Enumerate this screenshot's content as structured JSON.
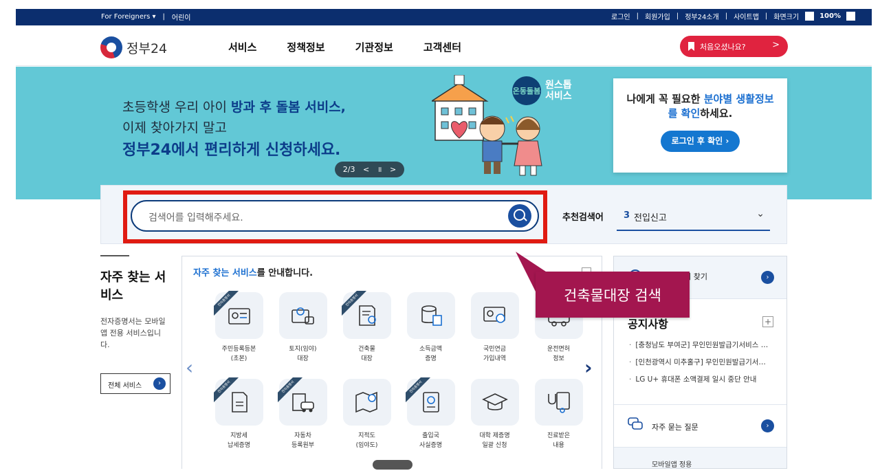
{
  "topbar": {
    "foreigners": "For Foreigners ▾",
    "kids": "어린이",
    "login": "로그인",
    "signup": "회원가입",
    "intro": "정부24소개",
    "sitemap": "사이트맵",
    "zoom_label": "화면크기",
    "zoom_minus": "-",
    "zoom_value": "100%",
    "zoom_plus": "+"
  },
  "header": {
    "logo_text": "정부24",
    "nav": [
      "서비스",
      "정책정보",
      "기관정보",
      "고객센터"
    ],
    "first_visit": "처음오셨나요?",
    "first_visit_arrow": ">"
  },
  "hero": {
    "line1_pre": "초등학생 우리 아이 ",
    "line1_hl": "방과 후 돌봄 서비스,",
    "line2": "이제 찾아가지 말고",
    "line3": "정부24에서 편리하게 신청하세요.",
    "pager": {
      "current": "2/3",
      "prev": "<",
      "pause": "॥",
      "next": ">"
    },
    "badge_circle": "온동돌봄",
    "badge_text_1": "원스톱",
    "badge_text_2": "서비스",
    "card_pre": "나에게 꼭 필요한 ",
    "card_hl1": "분야별 생활정보",
    "card_hl2": "를 확인",
    "card_post": "하세요.",
    "card_button": "로그인 후 확인 ›"
  },
  "search": {
    "placeholder": "검색어를 입력해주세요.",
    "recommend_label": "추천검색어",
    "recommend_num": "3",
    "recommend_value": "전입신고",
    "dropdown_icon": "⌄"
  },
  "left": {
    "title": "자주 찾는 서비스",
    "desc": "전자증명서는 모바일 앱 전용 서비스입니다.",
    "all_button": "전체 서비스",
    "all_arrow": "›"
  },
  "services": {
    "title_hl": "자주 찾는 서비스",
    "title_rest": "를 안내합니다.",
    "ribbon_text": "전자증명서",
    "items": [
      {
        "label": "주민등록등본\n(초본)",
        "icon": "id-card-icon",
        "ribbon": true
      },
      {
        "label": "토지(임야)\n대장",
        "icon": "land-map-icon",
        "ribbon": false
      },
      {
        "label": "건축물\n대장",
        "icon": "building-doc-icon",
        "ribbon": true
      },
      {
        "label": "소득금액\n증명",
        "icon": "coins-doc-icon",
        "ribbon": false
      },
      {
        "label": "국민연금\n가입내역",
        "icon": "pension-icon",
        "ribbon": false
      },
      {
        "label": "운전면허\n정보",
        "icon": "driver-license-icon",
        "ribbon": false
      },
      {
        "label": "지방세\n납세증명",
        "icon": "tax-doc-icon",
        "ribbon": true
      },
      {
        "label": "자동차\n등록원부",
        "icon": "car-doc-icon",
        "ribbon": true
      },
      {
        "label": "지적도\n(임야도)",
        "icon": "cadastral-map-icon",
        "ribbon": false
      },
      {
        "label": "출입국\n사실증명",
        "icon": "passport-icon",
        "ribbon": true
      },
      {
        "label": "대학 제증명\n일괄 신청",
        "icon": "graduation-cap-icon",
        "ribbon": false
      },
      {
        "label": "진료받은\n내용",
        "icon": "stethoscope-icon",
        "ribbon": false
      }
    ],
    "prev": "‹",
    "next": "›"
  },
  "right": {
    "location_label": "위치 찾기",
    "notice_title": "공지사항",
    "notice_plus": "+",
    "notices": [
      "[충청남도 부여군] 무인민원발급기서비스 …",
      "[인천광역시 미추홀구] 무인민원발급기서…",
      "LG U+ 휴대폰 소액결제 일시 중단 안내"
    ],
    "faq": "자주 묻는 질문",
    "app": "모바일앱 정용",
    "arrow": "›"
  },
  "callout": {
    "text": "건축물대장 검색"
  },
  "colors": {
    "navy": "#0b2e6e",
    "hero_bg": "#62c8d6",
    "accent_red": "#e0233f",
    "callout": "#a3164f",
    "frame_red": "#e01b12"
  }
}
